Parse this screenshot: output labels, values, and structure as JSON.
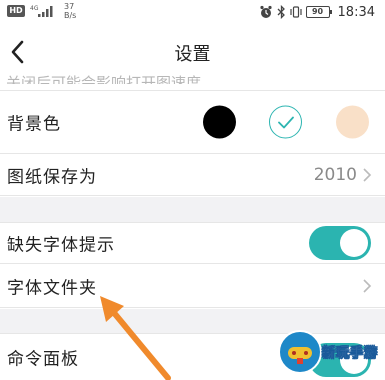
{
  "status_bar": {
    "hd_badge": "HD",
    "network": "4G",
    "speed_value": "37",
    "speed_unit": "B/s",
    "battery": "90",
    "time": "18:34"
  },
  "header": {
    "title": "设置",
    "partial_text": "关闭后可能会影响打开图速度"
  },
  "settings": {
    "background_color": {
      "label": "背景色",
      "selected": "white",
      "options": [
        "#000000",
        "#ffffff",
        "#f9e0c8"
      ]
    },
    "save_as": {
      "label": "图纸保存为",
      "value": "2010"
    },
    "missing_font_prompt": {
      "label": "缺失字体提示",
      "on": true
    },
    "font_folder": {
      "label": "字体文件夹"
    },
    "command_panel": {
      "label": "命令面板"
    }
  },
  "colors": {
    "accent": "#2bb4b0",
    "annotation_arrow": "#f08a2c"
  },
  "watermark": {
    "text": "新玩手游"
  }
}
